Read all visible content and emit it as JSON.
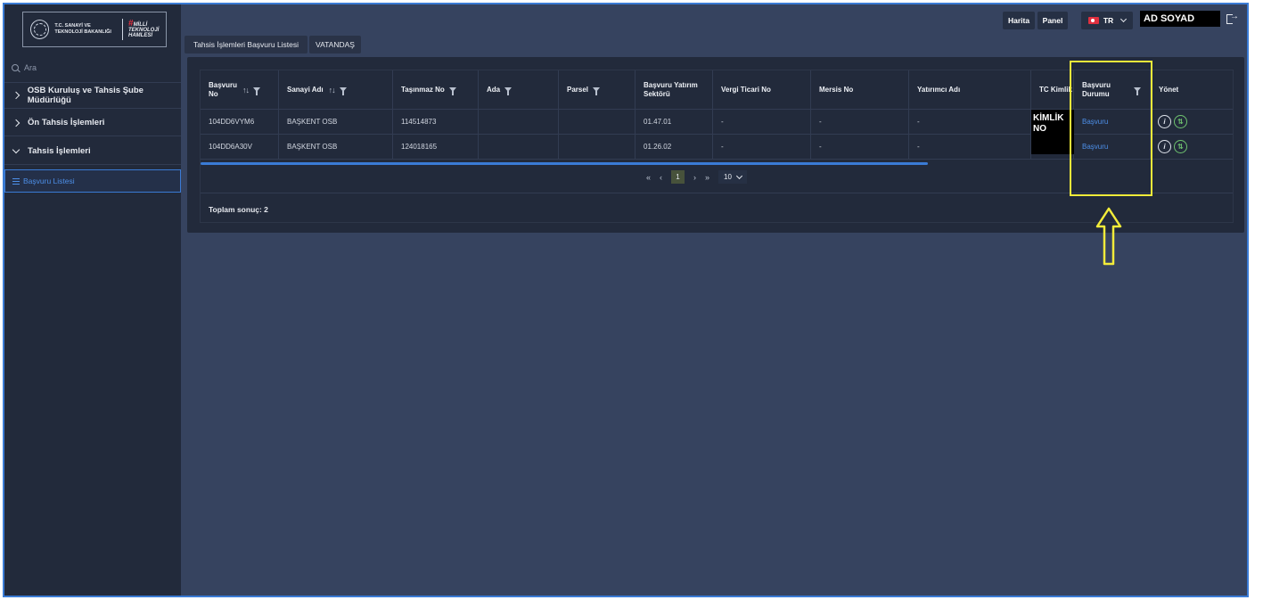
{
  "sidebar": {
    "logo": {
      "ministry_line1": "T.C. SANAYİ VE",
      "ministry_line2": "TEKNOLOJİ BAKANLIĞI",
      "brand_mark": "#",
      "brand_line1": "MİLLİ",
      "brand_line2": "TEKNOLOJİ",
      "brand_line3": "HAMLESİ"
    },
    "search_placeholder": "Ara",
    "items": [
      {
        "label": "OSB Kuruluş ve Tahsis Şube Müdürlüğü",
        "state": "collapsed"
      },
      {
        "label": "Ön Tahsis İşlemleri",
        "state": "collapsed"
      },
      {
        "label": "Tahsis İşlemleri",
        "state": "expanded"
      }
    ],
    "active_item": {
      "label": "Başvuru Listesi"
    }
  },
  "header": {
    "map_label": "Harita",
    "panel_label": "Panel",
    "language": "TR",
    "user_name": "AD SOYAD",
    "tabs": [
      {
        "label": "Tahsis İşlemleri Başvuru Listesi"
      },
      {
        "label": "VATANDAŞ"
      }
    ]
  },
  "table": {
    "columns": [
      {
        "line1": "Başvuru",
        "line2": "No"
      },
      {
        "line1": "Sanayi Adı",
        "line2": ""
      },
      {
        "line1": "Taşınmaz No",
        "line2": ""
      },
      {
        "line1": "Ada",
        "line2": ""
      },
      {
        "line1": "Parsel",
        "line2": ""
      },
      {
        "line1": "Başvuru Yatırım",
        "line2": "Sektörü"
      },
      {
        "line1": "Vergi Ticari No",
        "line2": ""
      },
      {
        "line1": "Mersis No",
        "line2": ""
      },
      {
        "line1": "Yatırımcı Adı",
        "line2": ""
      },
      {
        "line1": "TC Kimlik",
        "line2": ""
      },
      {
        "line1": "Başvuru",
        "line2": "Durumu"
      },
      {
        "line1": "Yönet",
        "line2": ""
      }
    ],
    "rows": [
      {
        "basvuru_no": "104DD6VYM6",
        "sanayi_adi": "BAŞKENT OSB",
        "tasinmaz_no": "114514873",
        "ada": "",
        "parsel": "",
        "sektor": "01.47.01",
        "vergi": "-",
        "mersis": "-",
        "yatirimci": "-",
        "durum": "Başvuru"
      },
      {
        "basvuru_no": "104DD6A30V",
        "sanayi_adi": "BAŞKENT OSB",
        "tasinmaz_no": "124018165",
        "ada": "",
        "parsel": "",
        "sektor": "01.26.02",
        "vergi": "-",
        "mersis": "-",
        "yatirimci": "-",
        "durum": "Başvuru"
      }
    ],
    "redaction": {
      "line1": "KİMLİK",
      "line2": "NO"
    },
    "pagination": {
      "current_page": "1",
      "page_size": "10"
    },
    "total": "Toplam sonuç: 2"
  },
  "colors": {
    "background": "#36435f",
    "sidebar": "#222a3b",
    "accent": "#3a7bd5",
    "highlight": "#f2ec3a"
  }
}
